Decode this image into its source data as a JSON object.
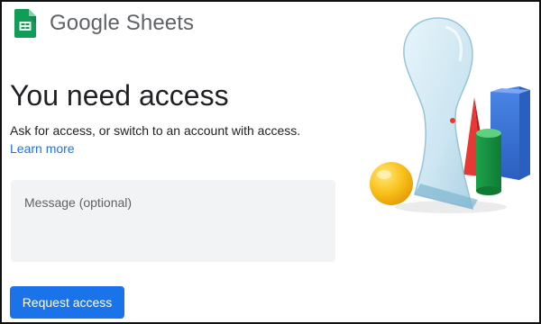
{
  "brand": {
    "name": "Google Sheets",
    "logo_icon": "sheets-logo-icon",
    "color": "#0F9D58"
  },
  "page": {
    "title": "You need access",
    "subtitle": "Ask for access, or switch to an account with access.",
    "learn_more": "Learn more"
  },
  "message": {
    "placeholder": "Message (optional)",
    "value": ""
  },
  "request_button": {
    "label": "Request access"
  },
  "colors": {
    "accent": "#1a73e8",
    "input_bg": "#f1f3f4",
    "title": "#202124",
    "muted": "#5f6368"
  },
  "illustration": {
    "icon": "keyhole-illustration"
  }
}
